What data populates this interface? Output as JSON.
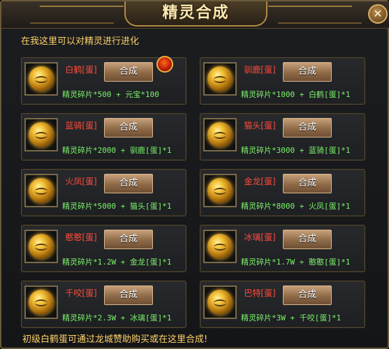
{
  "title": "精灵合成",
  "intro": "在我这里可以对精灵进行进化",
  "footer": "初级白鹤蛋可通过龙城赞助购买或在这里合成!",
  "close_label": "✕",
  "cards": [
    {
      "name": "白鹤[蛋]",
      "button": "合成",
      "recipe": "精灵碎片*500 + 元宝*100"
    },
    {
      "name": "驯鹿[蛋]",
      "button": "合成",
      "recipe": "精灵碎片*1000 + 白鹤[蛋]*1"
    },
    {
      "name": "蓝骑[蛋]",
      "button": "合成",
      "recipe": "精灵碎片*2000 + 驯鹿[蛋]*1"
    },
    {
      "name": "猫头[蛋]",
      "button": "合成",
      "recipe": "精灵碎片*3000 + 蓝骑[蛋]*1"
    },
    {
      "name": "火凤[蛋]",
      "button": "合成",
      "recipe": "精灵碎片*5000 + 猫头[蛋]*1"
    },
    {
      "name": "金龙[蛋]",
      "button": "合成",
      "recipe": "精灵碎片*8000 + 火凤[蛋]*1"
    },
    {
      "name": "憨憨[蛋]",
      "button": "合成",
      "recipe": "精灵碎片*1.2W + 金龙[蛋]*1"
    },
    {
      "name": "冰璃[蛋]",
      "button": "合成",
      "recipe": "精灵碎片*1.7W + 憨憨[蛋]*1"
    },
    {
      "name": "千咬[蛋]",
      "button": "合成",
      "recipe": "精灵碎片*2.3W + 冰璃[蛋]*1"
    },
    {
      "name": "巴特[蛋]",
      "button": "合成",
      "recipe": "精灵碎片*3W + 千咬[蛋]*1"
    }
  ]
}
